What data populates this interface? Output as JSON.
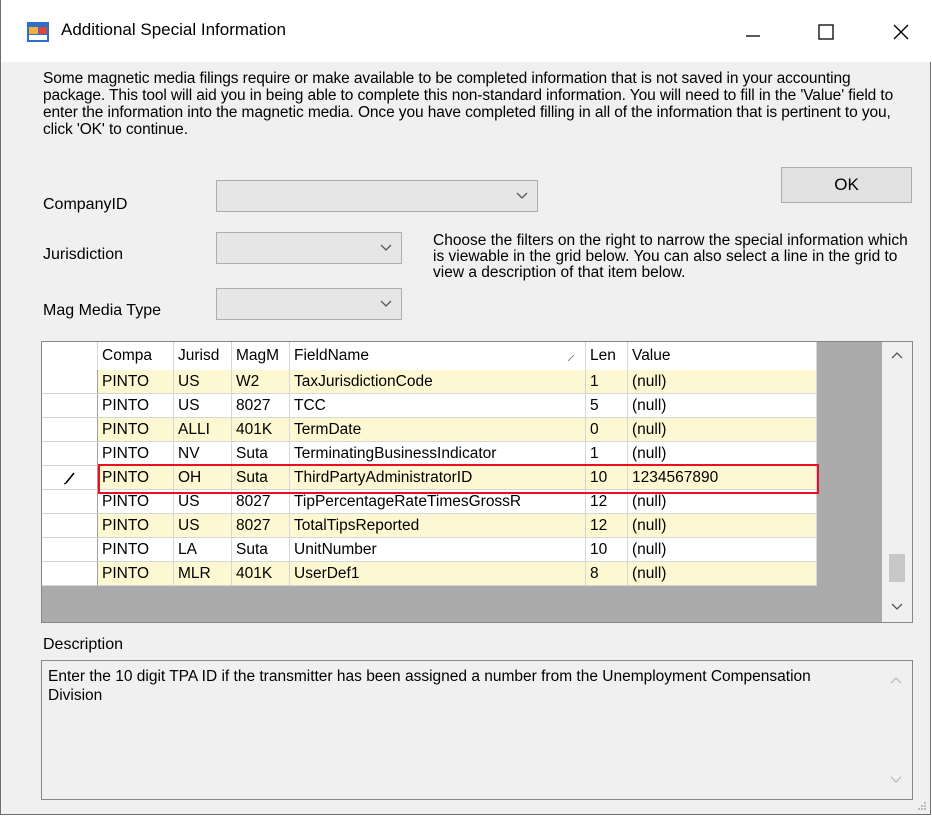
{
  "window": {
    "title": "Additional Special Information",
    "icon": "form-app-icon",
    "minimize_icon": "minimize-icon",
    "maximize_icon": "maximize-icon",
    "close_icon": "close-icon"
  },
  "intro_text": "Some magnetic media filings require or make available to be completed information that is not saved in your accounting package.  This tool will aid you in being able to complete this non-standard information. You will need to fill in the 'Value' field to enter the information into the magnetic media.  Once you have completed filling in all of the information that is pertinent to you, click 'OK' to continue.",
  "filters": {
    "company_label": "CompanyID",
    "company_value": "",
    "jurisdiction_label": "Jurisdiction",
    "jurisdiction_value": "",
    "mag_media_label": "Mag Media Type",
    "mag_media_value": ""
  },
  "ok_label": "OK",
  "hint_text": "Choose the filters on the right to narrow the special information which is viewable in the grid below.  You can also select a line in the grid to view a description of that item below.",
  "grid": {
    "columns": [
      "Compa",
      "Jurisd",
      "MagM",
      "FieldName",
      "Len",
      "Value"
    ],
    "sort_column": "FieldName",
    "rows": [
      {
        "company": "PINTO",
        "jurisdiction": "US",
        "mag": "W2",
        "field": "TaxJurisdictionCode",
        "len": "1",
        "value": "(null)",
        "alt": true
      },
      {
        "company": "PINTO",
        "jurisdiction": "US",
        "mag": "8027",
        "field": "TCC",
        "len": "5",
        "value": "(null)",
        "alt": false
      },
      {
        "company": "PINTO",
        "jurisdiction": "ALLI",
        "mag": "401K",
        "field": "TermDate",
        "len": "0",
        "value": "(null)",
        "alt": true
      },
      {
        "company": "PINTO",
        "jurisdiction": "NV",
        "mag": "Suta",
        "field": "TerminatingBusinessIndicator",
        "len": "1",
        "value": "(null)",
        "alt": false
      },
      {
        "company": "PINTO",
        "jurisdiction": "OH",
        "mag": "Suta",
        "field": "ThirdPartyAdministratorID",
        "len": "10",
        "value": "1234567890",
        "alt": true,
        "editing": true
      },
      {
        "company": "PINTO",
        "jurisdiction": "US",
        "mag": "8027",
        "field": "TipPercentageRateTimesGrossR",
        "len": "12",
        "value": "(null)",
        "alt": false
      },
      {
        "company": "PINTO",
        "jurisdiction": "US",
        "mag": "8027",
        "field": "TotalTipsReported",
        "len": "12",
        "value": "(null)",
        "alt": true
      },
      {
        "company": "PINTO",
        "jurisdiction": "LA",
        "mag": "Suta",
        "field": "UnitNumber",
        "len": "10",
        "value": "(null)",
        "alt": false
      },
      {
        "company": "PINTO",
        "jurisdiction": "MLR",
        "mag": "401K",
        "field": "UserDef1",
        "len": "8",
        "value": "(null)",
        "alt": true
      }
    ],
    "edit_row_icon": "pencil-icon",
    "highlight_color": "#e81123",
    "alt_row_color": "#fdf8d2"
  },
  "description": {
    "label": "Description",
    "text": "Enter the 10 digit TPA ID if the transmitter has been assigned a number from the Unemployment Compensation Division"
  }
}
